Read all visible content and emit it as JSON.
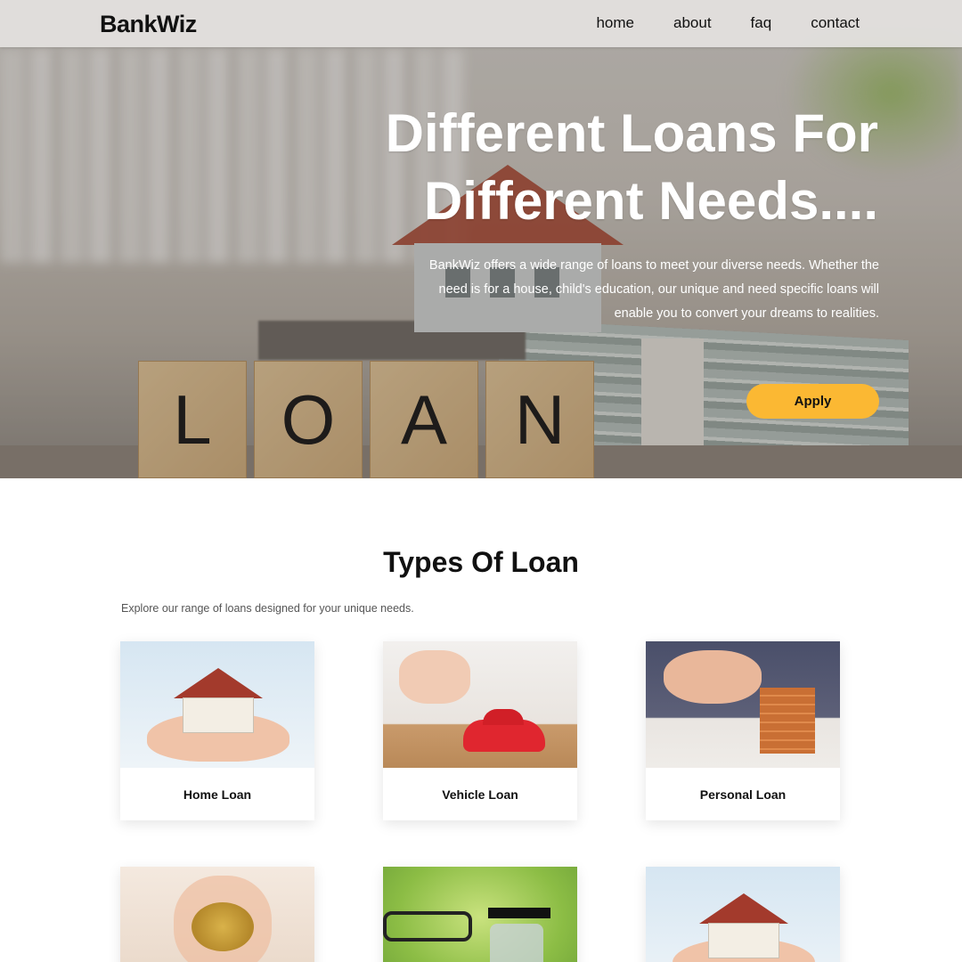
{
  "nav": {
    "logo": "BankWiz",
    "links": [
      "home",
      "about",
      "faq",
      "contact"
    ]
  },
  "hero": {
    "title_line1": "Different Loans For",
    "title_line2": "Different Needs....",
    "description": "BankWiz offers a wide range of loans to meet your diverse needs. Whether the need is for a house, child's education, our unique and need specific loans will enable you to convert your dreams to realities.",
    "apply_label": "Apply",
    "image_blocks": [
      "L",
      "O",
      "A",
      "N"
    ]
  },
  "types": {
    "title": "Types Of Loan",
    "subtitle": "Explore our range of loans designed for your unique needs.",
    "cards": [
      {
        "label": "Home Loan"
      },
      {
        "label": "Vehicle Loan"
      },
      {
        "label": "Personal Loan"
      }
    ]
  },
  "colors": {
    "accent": "#fbb833",
    "text": "#111111",
    "nav_bg": "#e4e2df"
  }
}
